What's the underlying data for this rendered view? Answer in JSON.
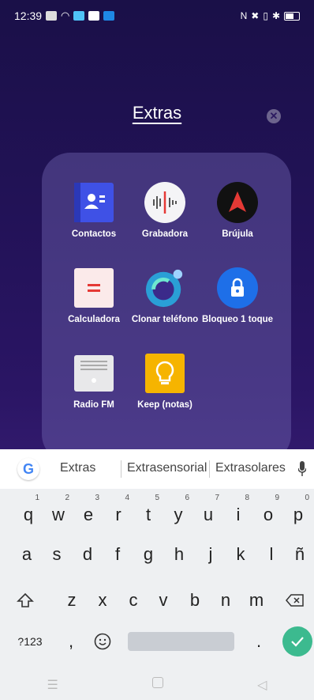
{
  "status_bar": {
    "time": "12:39"
  },
  "folder": {
    "title": "Extras"
  },
  "apps": [
    {
      "label": "Contactos",
      "icon": "contacts-icon"
    },
    {
      "label": "Grabadora",
      "icon": "recorder-icon"
    },
    {
      "label": "Brújula",
      "icon": "compass-icon"
    },
    {
      "label": "Calculadora",
      "icon": "calculator-icon"
    },
    {
      "label": "Clonar teléfono",
      "icon": "clone-phone-icon"
    },
    {
      "label": "Bloqueo 1 toque",
      "icon": "lock-icon"
    },
    {
      "label": "Radio FM",
      "icon": "radio-icon"
    },
    {
      "label": "Keep (notas)",
      "icon": "lightbulb-icon"
    }
  ],
  "keyboard": {
    "suggestions": [
      "Extras",
      "Extrasensorial",
      "Extrasolares"
    ],
    "row1": [
      {
        "k": "q",
        "n": "1"
      },
      {
        "k": "w",
        "n": "2"
      },
      {
        "k": "e",
        "n": "3"
      },
      {
        "k": "r",
        "n": "4"
      },
      {
        "k": "t",
        "n": "5"
      },
      {
        "k": "y",
        "n": "6"
      },
      {
        "k": "u",
        "n": "7"
      },
      {
        "k": "i",
        "n": "8"
      },
      {
        "k": "o",
        "n": "9"
      },
      {
        "k": "p",
        "n": "0"
      }
    ],
    "row2": [
      "a",
      "s",
      "d",
      "f",
      "g",
      "h",
      "j",
      "k",
      "l",
      "ñ"
    ],
    "row3": [
      "z",
      "x",
      "c",
      "v",
      "b",
      "n",
      "m"
    ],
    "num_key": "?123",
    "comma": ",",
    "period": "."
  },
  "colors": {
    "accent_enter": "#3cba8f",
    "folder_bg": "#6e64af"
  }
}
